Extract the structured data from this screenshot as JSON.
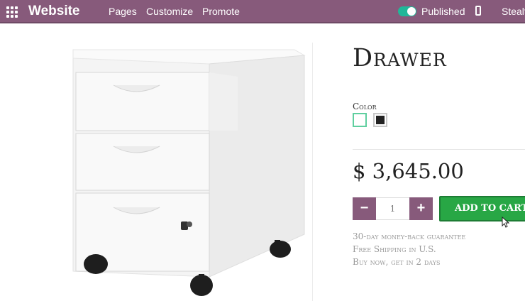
{
  "topbar": {
    "apps_icon": "apps-grid-icon",
    "brand": "Website",
    "menu": [
      "Pages",
      "Customize",
      "Promote"
    ],
    "published": "Published",
    "mobile_icon": "mobile-phone-icon",
    "theme": "Stealt"
  },
  "product": {
    "title": "Drawer",
    "color_label": "Color",
    "colors": [
      "white",
      "black"
    ],
    "price": "$ 3,645.00",
    "quantity": "1",
    "minus_label": "−",
    "plus_label": "+",
    "add_to_cart": "ADD TO CART",
    "terms": [
      "30-day money-back guarantee",
      "Free Shipping in U.S.",
      "Buy now, get in 2 days"
    ]
  },
  "colors": {
    "topbar": "#875a7b",
    "toggle_on": "#21b799",
    "add_to_cart": "#28a745"
  }
}
